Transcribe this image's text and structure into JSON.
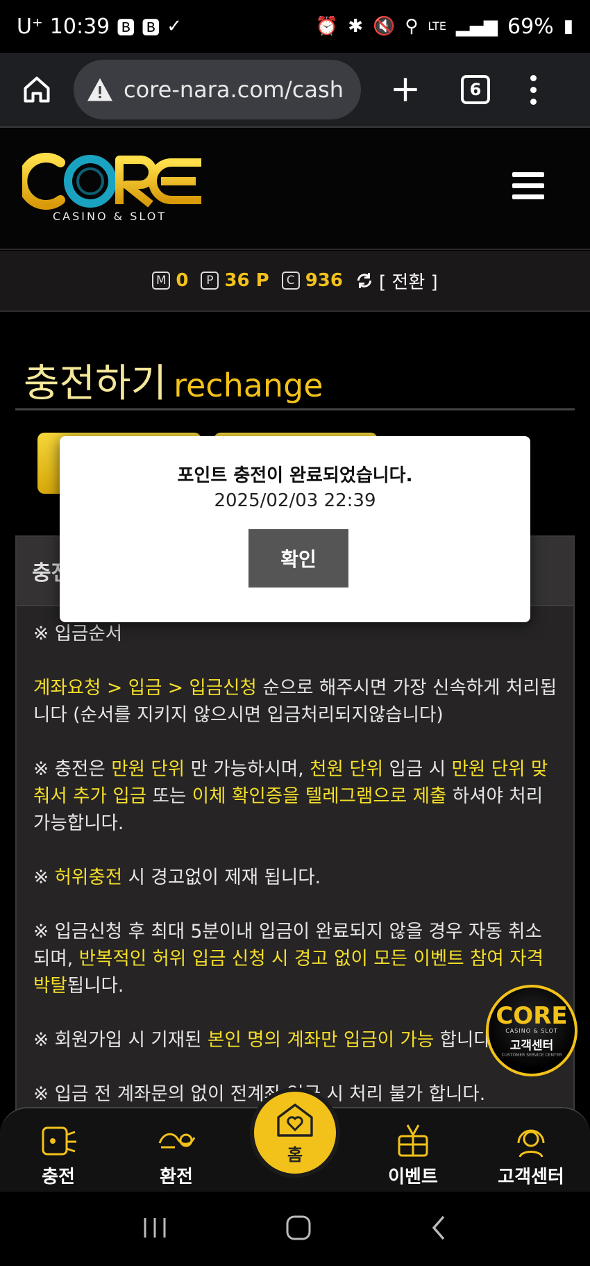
{
  "status_bar": {
    "carrier": "U⁺",
    "time": "10:39",
    "network": "LTE",
    "battery": "69%"
  },
  "browser": {
    "url": "core-nara.com/cash",
    "tab_count": "6"
  },
  "site": {
    "logo_main": "CORE",
    "logo_sub": "CASINO & SLOT"
  },
  "points": {
    "m_label": "M",
    "m_value": "0",
    "p_label": "P",
    "p_value": "36 P",
    "c_label": "C",
    "c_value": "936",
    "switch_label": "[ 전환 ]"
  },
  "page": {
    "title_kr": "충전하기",
    "title_en": "rechange"
  },
  "panel": {
    "header": "충전",
    "order_title": "※ 입금순서",
    "p1_hl": "계좌요청 > 입금 > 입금신청",
    "p1_rest": " 순으로 해주시면 가장 신속하게 처리됩니다 (순서를 지키지 않으시면 입금처리되지않습니다)",
    "p2_a": "※ 충전은 ",
    "p2_b": "만원 단위",
    "p2_c": " 만 가능하시며, ",
    "p2_d": "천원 단위",
    "p2_e": " 입금 시 ",
    "p2_f": "만원 단위 맞춰서 추가 입금",
    "p2_g": " 또는 ",
    "p2_h": "이체 확인증을 텔레그램으로 제출",
    "p2_i": " 하셔야 처리 가능합니다.",
    "p3_a": "※ ",
    "p3_b": "허위충전",
    "p3_c": " 시 경고없이 제재 됩니다.",
    "p4_a": "※ 입금신청 후 최대 5분이내 입금이 완료되지 않을 경우 자동 취소 되며, ",
    "p4_b": "반복적인 허위 입금 신청 시 경고 없이 모든 이벤트 참여 자격 박탈",
    "p4_c": "됩니다.",
    "p5_a": "※ 회원가입 시 기재된 ",
    "p5_b": "본인 명의 계좌만 입금이 가능",
    "p5_c": " 합니다.",
    "p6": "※ 입금 전 계좌문의 없이 전계좌 입금 시 처리 불가 합니다."
  },
  "chat_badge": {
    "main": "CORE",
    "sub": "CASINO & SLOT",
    "kr": "고객센터",
    "en": "CUSTOMER SERVICE CENTER"
  },
  "modal": {
    "title": "포인트 충전이 완료되었습니다.",
    "timestamp": "2025/02/03 22:39",
    "confirm_label": "확인"
  },
  "bottom_nav": {
    "charge": "충전",
    "exchange": "환전",
    "home": "홈",
    "event": "이벤트",
    "support": "고객센터"
  },
  "colors": {
    "brand_gold": "#f2c21a",
    "highlight_yellow": "#f5df2a",
    "brand_teal": "#1aa3c0"
  }
}
